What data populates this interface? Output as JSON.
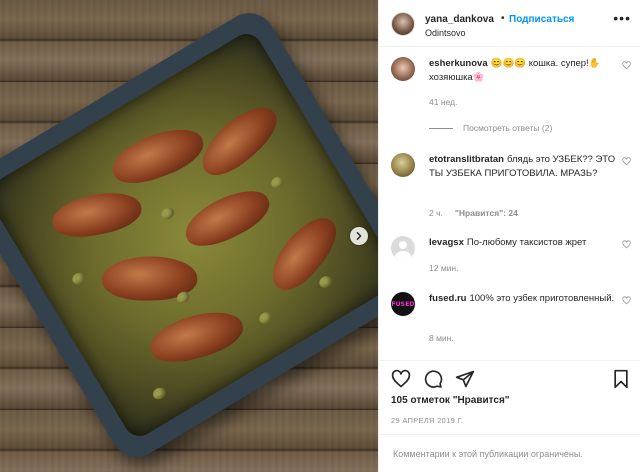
{
  "header": {
    "username": "yana_dankova",
    "dot": "•",
    "follow_label": "Подписаться",
    "location": "Odintsovo",
    "more": "•••"
  },
  "comments": [
    {
      "username": "esherkunova",
      "text": "😊😊😊 кошка. супер!✋ хозяюшка🌸",
      "time": "41 нед.",
      "replies": "Посмотреть ответы (2)"
    },
    {
      "username": "etotranslitbratan",
      "text": "блядь это УЗБЕК?? ЭТО ТЫ УЗБЕКА ПРИГОТОВИЛА. МРАЗЬ?",
      "time": "2 ч.",
      "likes": "\"Нравится\": 24"
    },
    {
      "username": "levagsx",
      "text": "По-любому таксистов жрет",
      "time": "12 мин."
    },
    {
      "username": "fused.ru",
      "text": "100% это узбек приготовленный.",
      "time": "8 мин.",
      "avatar_text": "FUSED"
    }
  ],
  "actions": {
    "icons": [
      "heart-icon",
      "comment-icon",
      "share-icon",
      "bookmark-icon"
    ],
    "likes_count": "105 отметок \"Нравится\"",
    "date": "29 АПРЕЛЯ 2019 Г.",
    "comments_limited": "Комментарии к этой публикации ограничены."
  },
  "colors": {
    "link_blue": "#0095f6",
    "muted": "#8e8e8e",
    "text": "#262626"
  }
}
